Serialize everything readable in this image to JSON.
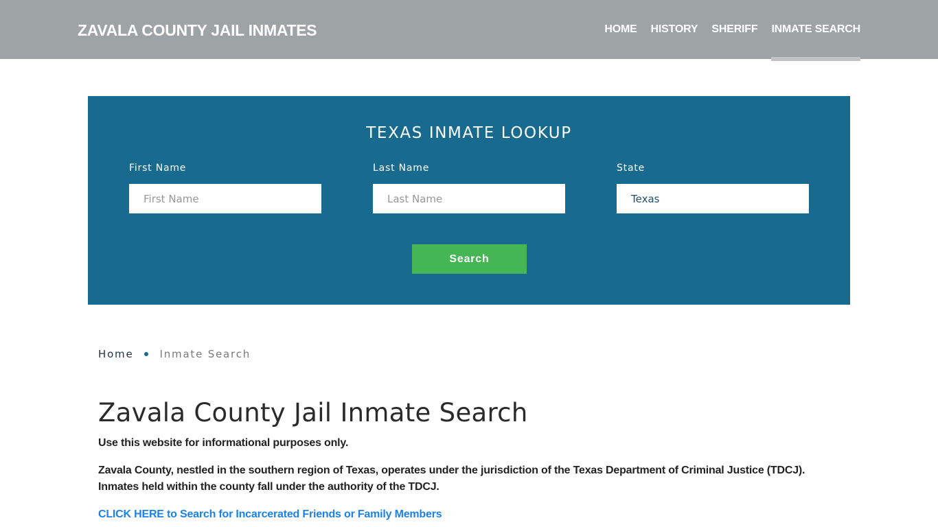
{
  "header": {
    "brand": "ZAVALA COUNTY JAIL INMATES",
    "nav": [
      {
        "label": "HOME",
        "active": false
      },
      {
        "label": "HISTORY",
        "active": false
      },
      {
        "label": "SHERIFF",
        "active": false
      },
      {
        "label": "INMATE SEARCH",
        "active": true
      }
    ]
  },
  "lookup": {
    "title": "TEXAS INMATE LOOKUP",
    "fields": {
      "first_name": {
        "label": "First Name",
        "placeholder": "First Name",
        "value": ""
      },
      "last_name": {
        "label": "Last Name",
        "placeholder": "Last Name",
        "value": ""
      },
      "state": {
        "label": "State",
        "placeholder": "",
        "value": "Texas"
      }
    },
    "search_label": "Search"
  },
  "breadcrumb": {
    "home": "Home",
    "current": "Inmate Search"
  },
  "content": {
    "title": "Zavala County Jail Inmate Search",
    "disclaimer": "Use this website for informational purposes only.",
    "description": "Zavala County, nestled in the southern region of Texas, operates under the jurisdiction of the Texas Department of Criminal Justice (TDCJ). Inmates held within the county fall under the authority of the TDCJ.",
    "cta_link": "CLICK HERE to Search for Incarcerated Friends or Family Members"
  },
  "colors": {
    "header_bg": "#9ea3a6",
    "panel_bg": "#186a8e",
    "button_bg": "#45b555",
    "link": "#1a82e8",
    "active_underline": "#c0c3c4"
  }
}
